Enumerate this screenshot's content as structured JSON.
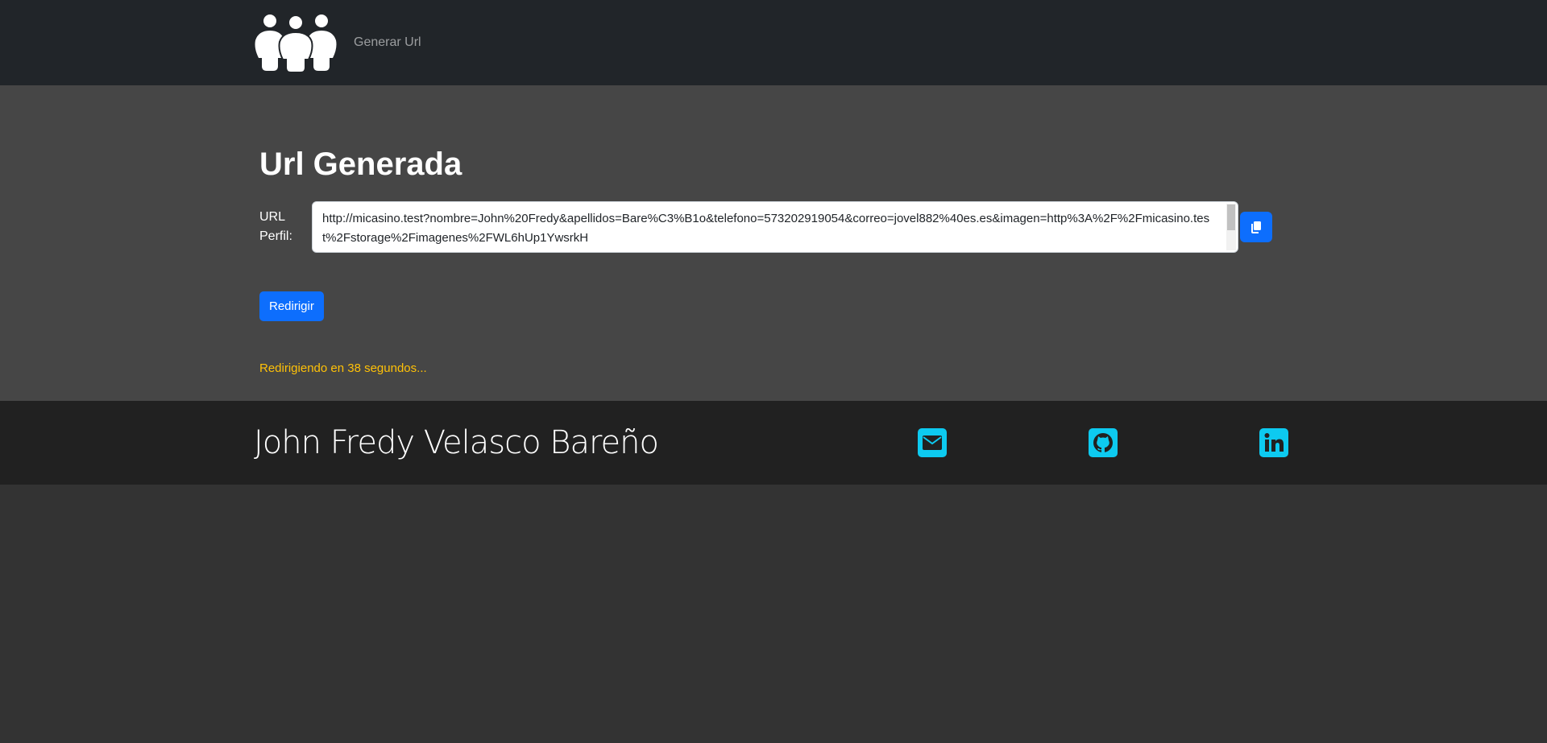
{
  "navbar": {
    "link": "Generar Url"
  },
  "main": {
    "title": "Url Generada",
    "url_label": "URL Perfil:",
    "url_value": "http://micasino.test?nombre=John%20Fredy&apellidos=Bare%C3%B1o&telefono=573202919054&correo=jovel882%40es.es&imagen=http%3A%2F%2Fmicasino.test%2Fstorage%2Fimagenes%2FWL6hUp1YwsrkH",
    "redirect_button": "Redirigir",
    "countdown": "Redirigiendo en 38 segundos..."
  },
  "footer": {
    "name": "John Fredy Velasco Bareño",
    "icons": [
      "email-icon",
      "github-icon",
      "linkedin-icon"
    ]
  },
  "colors": {
    "primary": "#0d6efd",
    "warning": "#ffc107",
    "social": "#0dcaf0"
  }
}
